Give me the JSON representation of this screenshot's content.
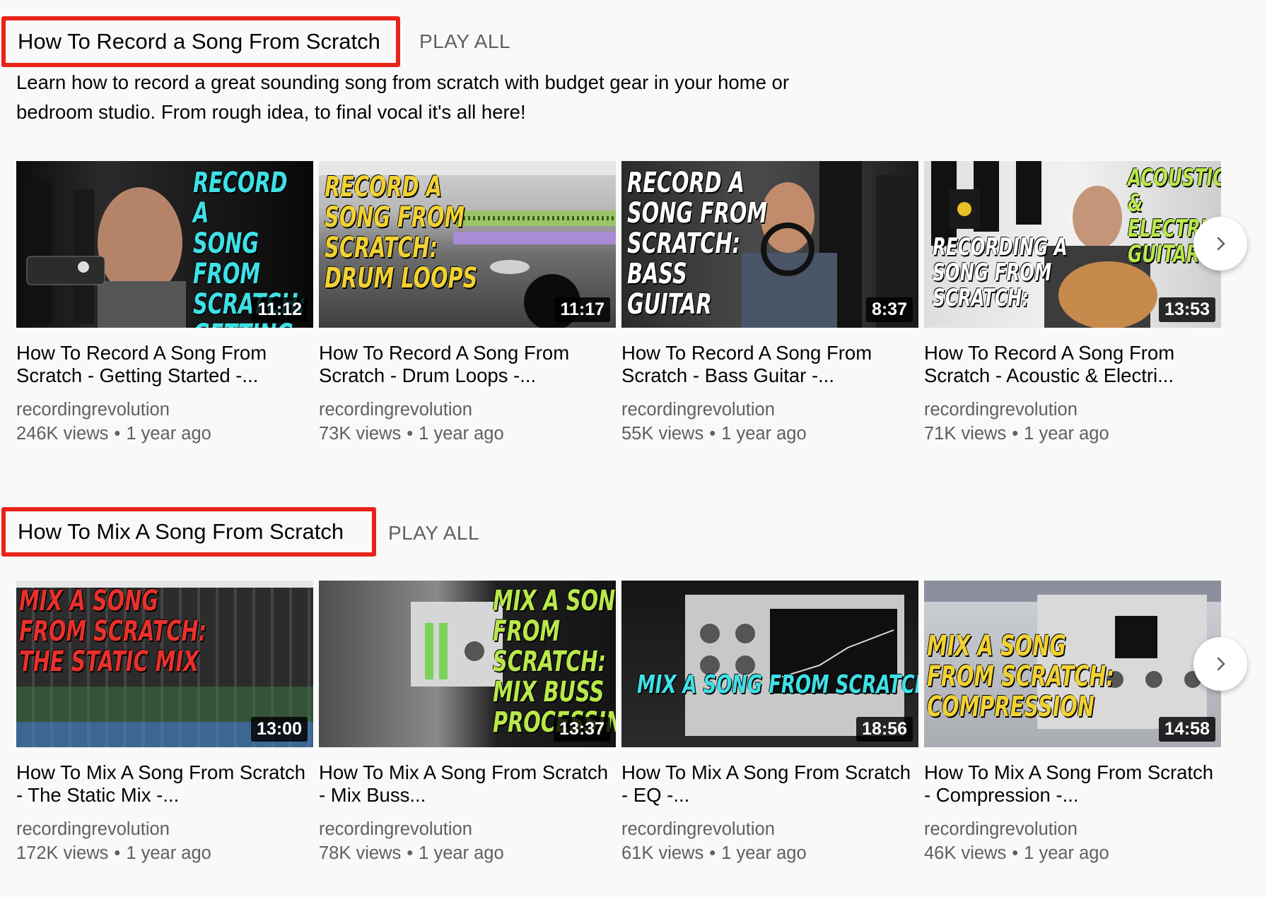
{
  "shelves": [
    {
      "title": "How To Record a Song From Scratch",
      "play_all": "PLAY ALL",
      "description": "Learn how to record a great sounding song from scratch with budget gear in your home or bedroom studio. From rough idea, to final vocal it's all here!",
      "videos": [
        {
          "thumb_text": "RECORD A\nSONG FROM\nSCRATCH:\nGETTING\nSTARTED",
          "duration": "11:12",
          "title": "How To Record A Song From Scratch - Getting Started -...",
          "channel": "recordingrevolution",
          "views": "246K views",
          "age": "1 year ago"
        },
        {
          "thumb_text": "RECORD A\nSONG FROM\nSCRATCH:\nDRUM LOOPS",
          "duration": "11:17",
          "title": "How To Record A Song From Scratch - Drum Loops -...",
          "channel": "recordingrevolution",
          "views": "73K views",
          "age": "1 year ago"
        },
        {
          "thumb_text": "RECORD A\nSONG FROM\nSCRATCH:\nBASS\nGUITAR",
          "duration": "8:37",
          "title": "How To Record A Song From Scratch - Bass Guitar -...",
          "channel": "recordingrevolution",
          "views": "55K views",
          "age": "1 year ago"
        },
        {
          "thumb_text": "ACOUSTIC &\nELECTRIC\nGUITARS",
          "thumb_text_2": "RECORDING A\nSONG FROM\nSCRATCH:",
          "duration": "13:53",
          "title": "How To Record A Song From Scratch - Acoustic & Electri...",
          "channel": "recordingrevolution",
          "views": "71K views",
          "age": "1 year ago"
        }
      ]
    },
    {
      "title": "How To Mix A Song From Scratch",
      "play_all": "PLAY ALL",
      "videos": [
        {
          "thumb_text": "MIX A SONG\nFROM SCRATCH:\nTHE STATIC MIX",
          "duration": "13:00",
          "title": "How To Mix A Song From Scratch - The Static Mix -...",
          "channel": "recordingrevolution",
          "views": "172K views",
          "age": "1 year ago"
        },
        {
          "thumb_text": "MIX A SONG\nFROM\nSCRATCH:\nMIX BUSS\nPROCESSING",
          "duration": "13:37",
          "title": "How To Mix A Song From Scratch - Mix Buss...",
          "channel": "recordingrevolution",
          "views": "78K views",
          "age": "1 year ago"
        },
        {
          "thumb_text": "MIX A SONG FROM SCRATCH: EQ",
          "duration": "18:56",
          "title": "How To Mix A Song From Scratch - EQ -...",
          "channel": "recordingrevolution",
          "views": "61K views",
          "age": "1 year ago"
        },
        {
          "thumb_text": "MIX A SONG\nFROM SCRATCH:\nCOMPRESSION",
          "duration": "14:58",
          "title": "How To Mix A Song From Scratch - Compression -...",
          "channel": "recordingrevolution",
          "views": "46K views",
          "age": "1 year ago"
        }
      ]
    }
  ],
  "icons": {
    "next": "chevron-right-icon",
    "separator": "•"
  },
  "colors": {
    "highlight_border": "#e8231a",
    "thumb_text_cyan": "#3fe0e6",
    "thumb_text_yellow": "#f2d233",
    "thumb_text_red": "#e8312b",
    "thumb_text_green": "#b8e84b",
    "secondary_text": "#606060"
  }
}
